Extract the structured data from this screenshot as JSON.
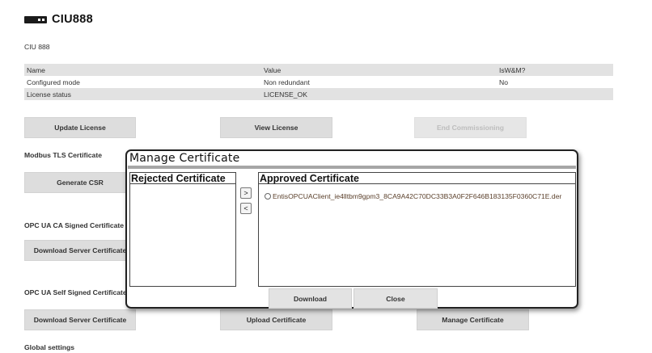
{
  "header": {
    "title": "CIU888",
    "device_icon": "device-icon"
  },
  "subtitle": "CIU 888",
  "info_table": {
    "columns": [
      "Name",
      "Value",
      "IsW&M?"
    ],
    "rows": [
      {
        "name": "Configured mode",
        "value": "Non redundant",
        "isWM": "No"
      },
      {
        "name": "License status",
        "value": "LICENSE_OK",
        "isWM": ""
      }
    ]
  },
  "license_buttons": {
    "update": "Update License",
    "view": "View License",
    "end": "End Commissioning"
  },
  "sections": {
    "modbus_tls": "Modbus TLS Certificate",
    "opc_ca": "OPC UA CA Signed Certificate",
    "opc_self": "OPC UA Self Signed Certificate",
    "global": "Global settings"
  },
  "buttons": {
    "generate_csr": "Generate CSR",
    "download_server_cert_ca": "Download Server Certificate",
    "download_server_cert_self": "Download Server Certificate",
    "upload_certificate": "Upload Certificate",
    "manage_certificate": "Manage Certificate"
  },
  "modal": {
    "title": "Manage Certificate",
    "rejected_header": "Rejected Certificate",
    "approved_header": "Approved Certificate",
    "approved_items": [
      "EntisOPCUAClient_ie4lltbm9gpm3_8CA9A42C70DC33B3A0F2F646B183135F0360C71E.der"
    ],
    "move_right": ">",
    "move_left": "<",
    "download": "Download",
    "close": "Close"
  },
  "colors": {
    "shaded_row": "#e2e2e2",
    "button_bg": "#dddddd",
    "modal_border": "#222222",
    "item_text": "#5a3f2a"
  }
}
